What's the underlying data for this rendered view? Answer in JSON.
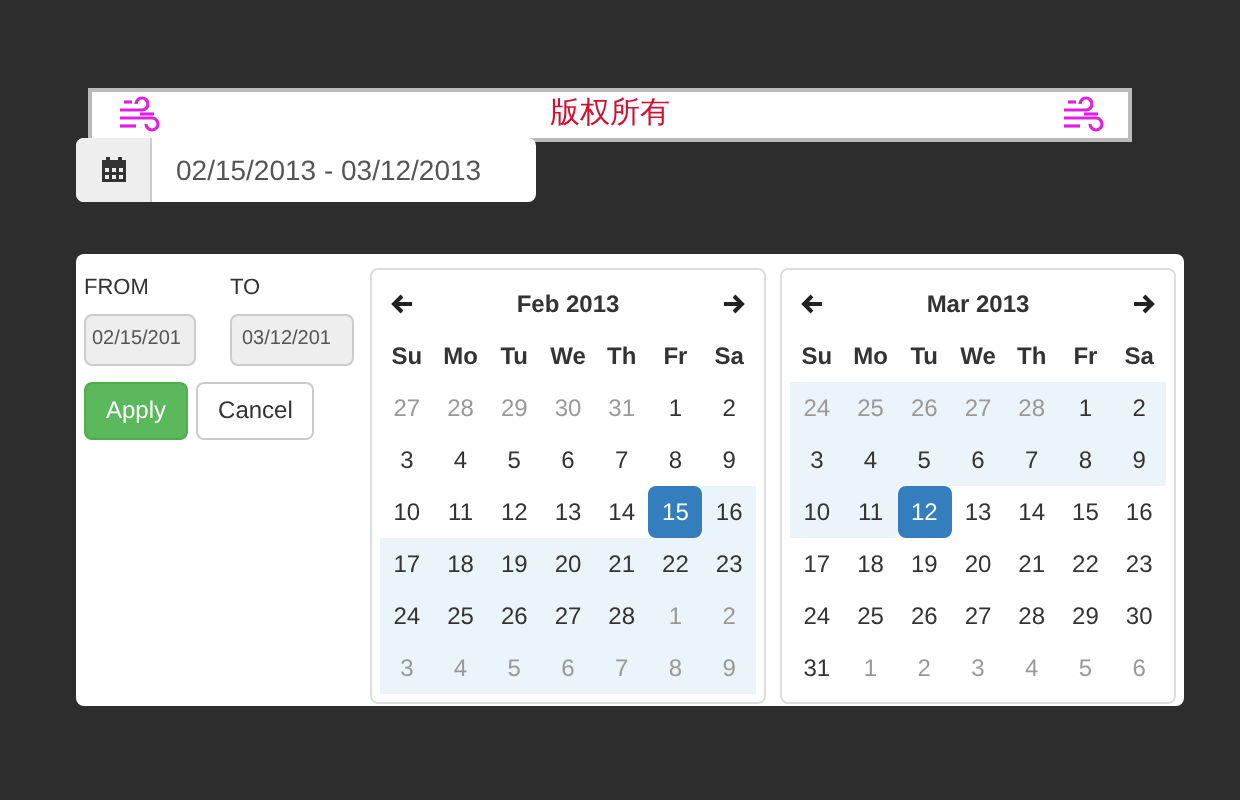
{
  "banner": {
    "text": "版权所有"
  },
  "range_input": {
    "value": "02/15/2013 - 03/12/2013"
  },
  "ranges": {
    "from_label": "FROM",
    "from_value": "02/15/201",
    "to_label": "TO",
    "to_value": "03/12/201",
    "buttons": [
      {
        "kind": "apply",
        "label": "Apply"
      },
      {
        "kind": "cancel",
        "label": "Cancel"
      }
    ]
  },
  "calendars": [
    {
      "title": "Feb 2013",
      "weekdays": [
        "Su",
        "Mo",
        "Tu",
        "We",
        "Th",
        "Fr",
        "Sa"
      ],
      "weeks": [
        [
          {
            "text": "27",
            "muted": true,
            "in_range": false,
            "selected": false
          },
          {
            "text": "28",
            "muted": true,
            "in_range": false,
            "selected": false
          },
          {
            "text": "29",
            "muted": true,
            "in_range": false,
            "selected": false
          },
          {
            "text": "30",
            "muted": true,
            "in_range": false,
            "selected": false
          },
          {
            "text": "31",
            "muted": true,
            "in_range": false,
            "selected": false
          },
          {
            "text": "1",
            "muted": false,
            "in_range": false,
            "selected": false
          },
          {
            "text": "2",
            "muted": false,
            "in_range": false,
            "selected": false
          }
        ],
        [
          {
            "text": "3",
            "muted": false,
            "in_range": false,
            "selected": false
          },
          {
            "text": "4",
            "muted": false,
            "in_range": false,
            "selected": false
          },
          {
            "text": "5",
            "muted": false,
            "in_range": false,
            "selected": false
          },
          {
            "text": "6",
            "muted": false,
            "in_range": false,
            "selected": false
          },
          {
            "text": "7",
            "muted": false,
            "in_range": false,
            "selected": false
          },
          {
            "text": "8",
            "muted": false,
            "in_range": false,
            "selected": false
          },
          {
            "text": "9",
            "muted": false,
            "in_range": false,
            "selected": false
          }
        ],
        [
          {
            "text": "10",
            "muted": false,
            "in_range": false,
            "selected": false
          },
          {
            "text": "11",
            "muted": false,
            "in_range": false,
            "selected": false
          },
          {
            "text": "12",
            "muted": false,
            "in_range": false,
            "selected": false
          },
          {
            "text": "13",
            "muted": false,
            "in_range": false,
            "selected": false
          },
          {
            "text": "14",
            "muted": false,
            "in_range": false,
            "selected": false
          },
          {
            "text": "15",
            "muted": false,
            "in_range": false,
            "selected": true
          },
          {
            "text": "16",
            "muted": false,
            "in_range": true,
            "selected": false
          }
        ],
        [
          {
            "text": "17",
            "muted": false,
            "in_range": true,
            "selected": false
          },
          {
            "text": "18",
            "muted": false,
            "in_range": true,
            "selected": false
          },
          {
            "text": "19",
            "muted": false,
            "in_range": true,
            "selected": false
          },
          {
            "text": "20",
            "muted": false,
            "in_range": true,
            "selected": false
          },
          {
            "text": "21",
            "muted": false,
            "in_range": true,
            "selected": false
          },
          {
            "text": "22",
            "muted": false,
            "in_range": true,
            "selected": false
          },
          {
            "text": "23",
            "muted": false,
            "in_range": true,
            "selected": false
          }
        ],
        [
          {
            "text": "24",
            "muted": false,
            "in_range": true,
            "selected": false
          },
          {
            "text": "25",
            "muted": false,
            "in_range": true,
            "selected": false
          },
          {
            "text": "26",
            "muted": false,
            "in_range": true,
            "selected": false
          },
          {
            "text": "27",
            "muted": false,
            "in_range": true,
            "selected": false
          },
          {
            "text": "28",
            "muted": false,
            "in_range": true,
            "selected": false
          },
          {
            "text": "1",
            "muted": true,
            "in_range": true,
            "selected": false
          },
          {
            "text": "2",
            "muted": true,
            "in_range": true,
            "selected": false
          }
        ],
        [
          {
            "text": "3",
            "muted": true,
            "in_range": true,
            "selected": false
          },
          {
            "text": "4",
            "muted": true,
            "in_range": true,
            "selected": false
          },
          {
            "text": "5",
            "muted": true,
            "in_range": true,
            "selected": false
          },
          {
            "text": "6",
            "muted": true,
            "in_range": true,
            "selected": false
          },
          {
            "text": "7",
            "muted": true,
            "in_range": true,
            "selected": false
          },
          {
            "text": "8",
            "muted": true,
            "in_range": true,
            "selected": false
          },
          {
            "text": "9",
            "muted": true,
            "in_range": true,
            "selected": false
          }
        ]
      ]
    },
    {
      "title": "Mar 2013",
      "weekdays": [
        "Su",
        "Mo",
        "Tu",
        "We",
        "Th",
        "Fr",
        "Sa"
      ],
      "weeks": [
        [
          {
            "text": "24",
            "muted": true,
            "in_range": true,
            "selected": false
          },
          {
            "text": "25",
            "muted": true,
            "in_range": true,
            "selected": false
          },
          {
            "text": "26",
            "muted": true,
            "in_range": true,
            "selected": false
          },
          {
            "text": "27",
            "muted": true,
            "in_range": true,
            "selected": false
          },
          {
            "text": "28",
            "muted": true,
            "in_range": true,
            "selected": false
          },
          {
            "text": "1",
            "muted": false,
            "in_range": true,
            "selected": false
          },
          {
            "text": "2",
            "muted": false,
            "in_range": true,
            "selected": false
          }
        ],
        [
          {
            "text": "3",
            "muted": false,
            "in_range": true,
            "selected": false
          },
          {
            "text": "4",
            "muted": false,
            "in_range": true,
            "selected": false
          },
          {
            "text": "5",
            "muted": false,
            "in_range": true,
            "selected": false
          },
          {
            "text": "6",
            "muted": false,
            "in_range": true,
            "selected": false
          },
          {
            "text": "7",
            "muted": false,
            "in_range": true,
            "selected": false
          },
          {
            "text": "8",
            "muted": false,
            "in_range": true,
            "selected": false
          },
          {
            "text": "9",
            "muted": false,
            "in_range": true,
            "selected": false
          }
        ],
        [
          {
            "text": "10",
            "muted": false,
            "in_range": true,
            "selected": false
          },
          {
            "text": "11",
            "muted": false,
            "in_range": true,
            "selected": false
          },
          {
            "text": "12",
            "muted": false,
            "in_range": false,
            "selected": true
          },
          {
            "text": "13",
            "muted": false,
            "in_range": false,
            "selected": false
          },
          {
            "text": "14",
            "muted": false,
            "in_range": false,
            "selected": false
          },
          {
            "text": "15",
            "muted": false,
            "in_range": false,
            "selected": false
          },
          {
            "text": "16",
            "muted": false,
            "in_range": false,
            "selected": false
          }
        ],
        [
          {
            "text": "17",
            "muted": false,
            "in_range": false,
            "selected": false
          },
          {
            "text": "18",
            "muted": false,
            "in_range": false,
            "selected": false
          },
          {
            "text": "19",
            "muted": false,
            "in_range": false,
            "selected": false
          },
          {
            "text": "20",
            "muted": false,
            "in_range": false,
            "selected": false
          },
          {
            "text": "21",
            "muted": false,
            "in_range": false,
            "selected": false
          },
          {
            "text": "22",
            "muted": false,
            "in_range": false,
            "selected": false
          },
          {
            "text": "23",
            "muted": false,
            "in_range": false,
            "selected": false
          }
        ],
        [
          {
            "text": "24",
            "muted": false,
            "in_range": false,
            "selected": false
          },
          {
            "text": "25",
            "muted": false,
            "in_range": false,
            "selected": false
          },
          {
            "text": "26",
            "muted": false,
            "in_range": false,
            "selected": false
          },
          {
            "text": "27",
            "muted": false,
            "in_range": false,
            "selected": false
          },
          {
            "text": "28",
            "muted": false,
            "in_range": false,
            "selected": false
          },
          {
            "text": "29",
            "muted": false,
            "in_range": false,
            "selected": false
          },
          {
            "text": "30",
            "muted": false,
            "in_range": false,
            "selected": false
          }
        ],
        [
          {
            "text": "31",
            "muted": false,
            "in_range": false,
            "selected": false
          },
          {
            "text": "1",
            "muted": true,
            "in_range": false,
            "selected": false
          },
          {
            "text": "2",
            "muted": true,
            "in_range": false,
            "selected": false
          },
          {
            "text": "3",
            "muted": true,
            "in_range": false,
            "selected": false
          },
          {
            "text": "4",
            "muted": true,
            "in_range": false,
            "selected": false
          },
          {
            "text": "5",
            "muted": true,
            "in_range": false,
            "selected": false
          },
          {
            "text": "6",
            "muted": true,
            "in_range": false,
            "selected": false
          }
        ]
      ]
    }
  ]
}
